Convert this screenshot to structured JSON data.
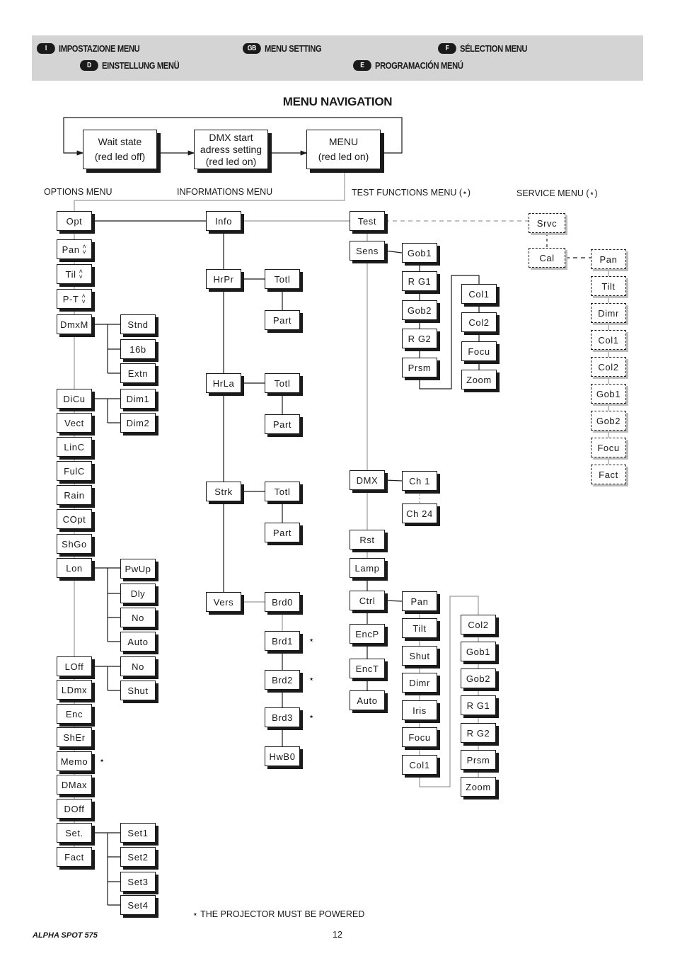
{
  "header": {
    "languages": [
      {
        "code": "I",
        "label": "IMPOSTAZIONE MENU"
      },
      {
        "code": "GB",
        "label": "MENU SETTING"
      },
      {
        "code": "F",
        "label": "SÉLECTION MENU"
      },
      {
        "code": "D",
        "label": "EINSTELLUNG MENÜ"
      },
      {
        "code": "E",
        "label": "PROGRAMACIÓN MENÚ"
      }
    ]
  },
  "title": "MENU NAVIGATION",
  "states": {
    "wait": {
      "line1": "Wait state",
      "line2": "(red led off)"
    },
    "dmx": {
      "line1": "DMX start",
      "line2": "adress setting",
      "line3": "(red led on)"
    },
    "menu": {
      "line1": "MENU",
      "line2": "(red led on)"
    }
  },
  "sections": {
    "options": "OPTIONS MENU",
    "info": "INFORMATIONS MENU",
    "test": "TEST FUNCTIONS MENU (⋆)",
    "service": "SERVICE MENU (⋆)"
  },
  "options_menu": {
    "root": "Opt",
    "items": [
      {
        "label": "Pan",
        "arrows": true
      },
      {
        "label": "Til",
        "arrows": true
      },
      {
        "label": "P-T",
        "arrows": true
      },
      {
        "label": "DmxM",
        "children": [
          "Stnd",
          "16b",
          "Extn"
        ]
      },
      {
        "label": "DiCu",
        "children": [
          "Dim1",
          "Dim2"
        ]
      },
      {
        "label": "Vect"
      },
      {
        "label": "LinC"
      },
      {
        "label": "FulC"
      },
      {
        "label": "Rain"
      },
      {
        "label": "COpt"
      },
      {
        "label": "ShGo"
      },
      {
        "label": "Lon",
        "children": [
          "PwUp",
          "Dly",
          "No",
          "Auto"
        ]
      },
      {
        "label": "LOff",
        "children": [
          "No",
          "Shut"
        ]
      },
      {
        "label": "LDmx"
      },
      {
        "label": "Enc"
      },
      {
        "label": "ShEr"
      },
      {
        "label": "Memo",
        "star": true
      },
      {
        "label": "DMax"
      },
      {
        "label": "DOff"
      },
      {
        "label": "Set.",
        "children": [
          "Set1",
          "Set2",
          "Set3",
          "Set4"
        ]
      },
      {
        "label": "Fact"
      }
    ]
  },
  "info_menu": {
    "root": "Info",
    "items": [
      {
        "label": "HrPr",
        "children": [
          "Totl",
          "Part"
        ]
      },
      {
        "label": "HrLa",
        "children": [
          "Totl",
          "Part"
        ]
      },
      {
        "label": "Strk",
        "children": [
          "Totl",
          "Part"
        ]
      },
      {
        "label": "Vers",
        "children": [
          "Brd0",
          "Brd1",
          "Brd2",
          "Brd3",
          "HwB0"
        ],
        "starred_children": [
          1,
          2,
          3
        ]
      }
    ]
  },
  "test_menu": {
    "root": "Test",
    "items": [
      {
        "label": "Sens",
        "children": [
          "Gob1",
          "R G1",
          "Gob2",
          "R G2",
          "Prsm"
        ],
        "continued": [
          "Col1",
          "Col2",
          "Focu",
          "Zoom"
        ]
      },
      {
        "label": "DMX",
        "children": [
          "Ch 1",
          "Ch 24"
        ]
      },
      {
        "label": "Rst"
      },
      {
        "label": "Lamp"
      },
      {
        "label": "Ctrl",
        "children": [
          "Pan",
          "Tilt",
          "Shut",
          "Dimr",
          "Iris",
          "Focu",
          "Col1"
        ],
        "continued": [
          "Col2",
          "Gob1",
          "Gob2",
          "R G1",
          "R G2",
          "Prsm",
          "Zoom"
        ]
      },
      {
        "label": "EncP"
      },
      {
        "label": "EncT"
      },
      {
        "label": "Auto"
      }
    ]
  },
  "service_menu": {
    "root": "Srvc",
    "cal": "Cal",
    "cal_children": [
      "Pan",
      "Tilt",
      "Dimr",
      "Col1",
      "Col2",
      "Gob1",
      "Gob2",
      "Focu",
      "Fact"
    ]
  },
  "star_symbol": "⋆",
  "footnote": "⋆ THE PROJECTOR MUST BE POWERED",
  "footer": {
    "brand": "ALPHA SPOT 575",
    "page": "12"
  }
}
